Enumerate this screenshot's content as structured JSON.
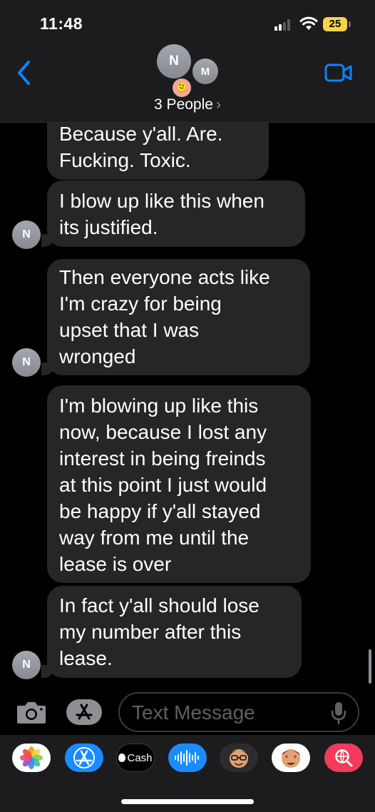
{
  "status_bar": {
    "time": "11:48",
    "battery": "25"
  },
  "header": {
    "avatars": [
      "N",
      "M"
    ],
    "emoji_avatar": "🫠",
    "group_name": "3 People",
    "chevron": "›"
  },
  "messages": [
    {
      "text": "Because y'all. Are.\nFucking. Toxic.",
      "sender": ""
    },
    {
      "text": "I blow up like this when\nits justified.",
      "sender": "N"
    },
    {
      "text": "Then everyone acts like\nI'm crazy for being\nupset that I was\nwronged",
      "sender": "N"
    },
    {
      "text": "I'm blowing up like this\nnow, because I lost any\ninterest in being freinds\nat this point I just would\nbe happy if y'all stayed\nway from me until the\nlease is over",
      "sender": ""
    },
    {
      "text": "In fact y'all should lose\nmy number after this\nlease.",
      "sender": "N"
    }
  ],
  "compose": {
    "placeholder": "Text Message"
  },
  "app_drawer": {
    "apps": [
      "photos-icon",
      "app-store-icon",
      "apple-cash-icon",
      "audio-message-icon",
      "memoji-icon",
      "memoji-stickers-icon",
      "search-images-icon"
    ],
    "cash_label": "Cash"
  },
  "colors": {
    "accent": "#0a84ff",
    "bubble": "#262628",
    "header": "#1c1c1e",
    "battery": "#f5d547"
  }
}
